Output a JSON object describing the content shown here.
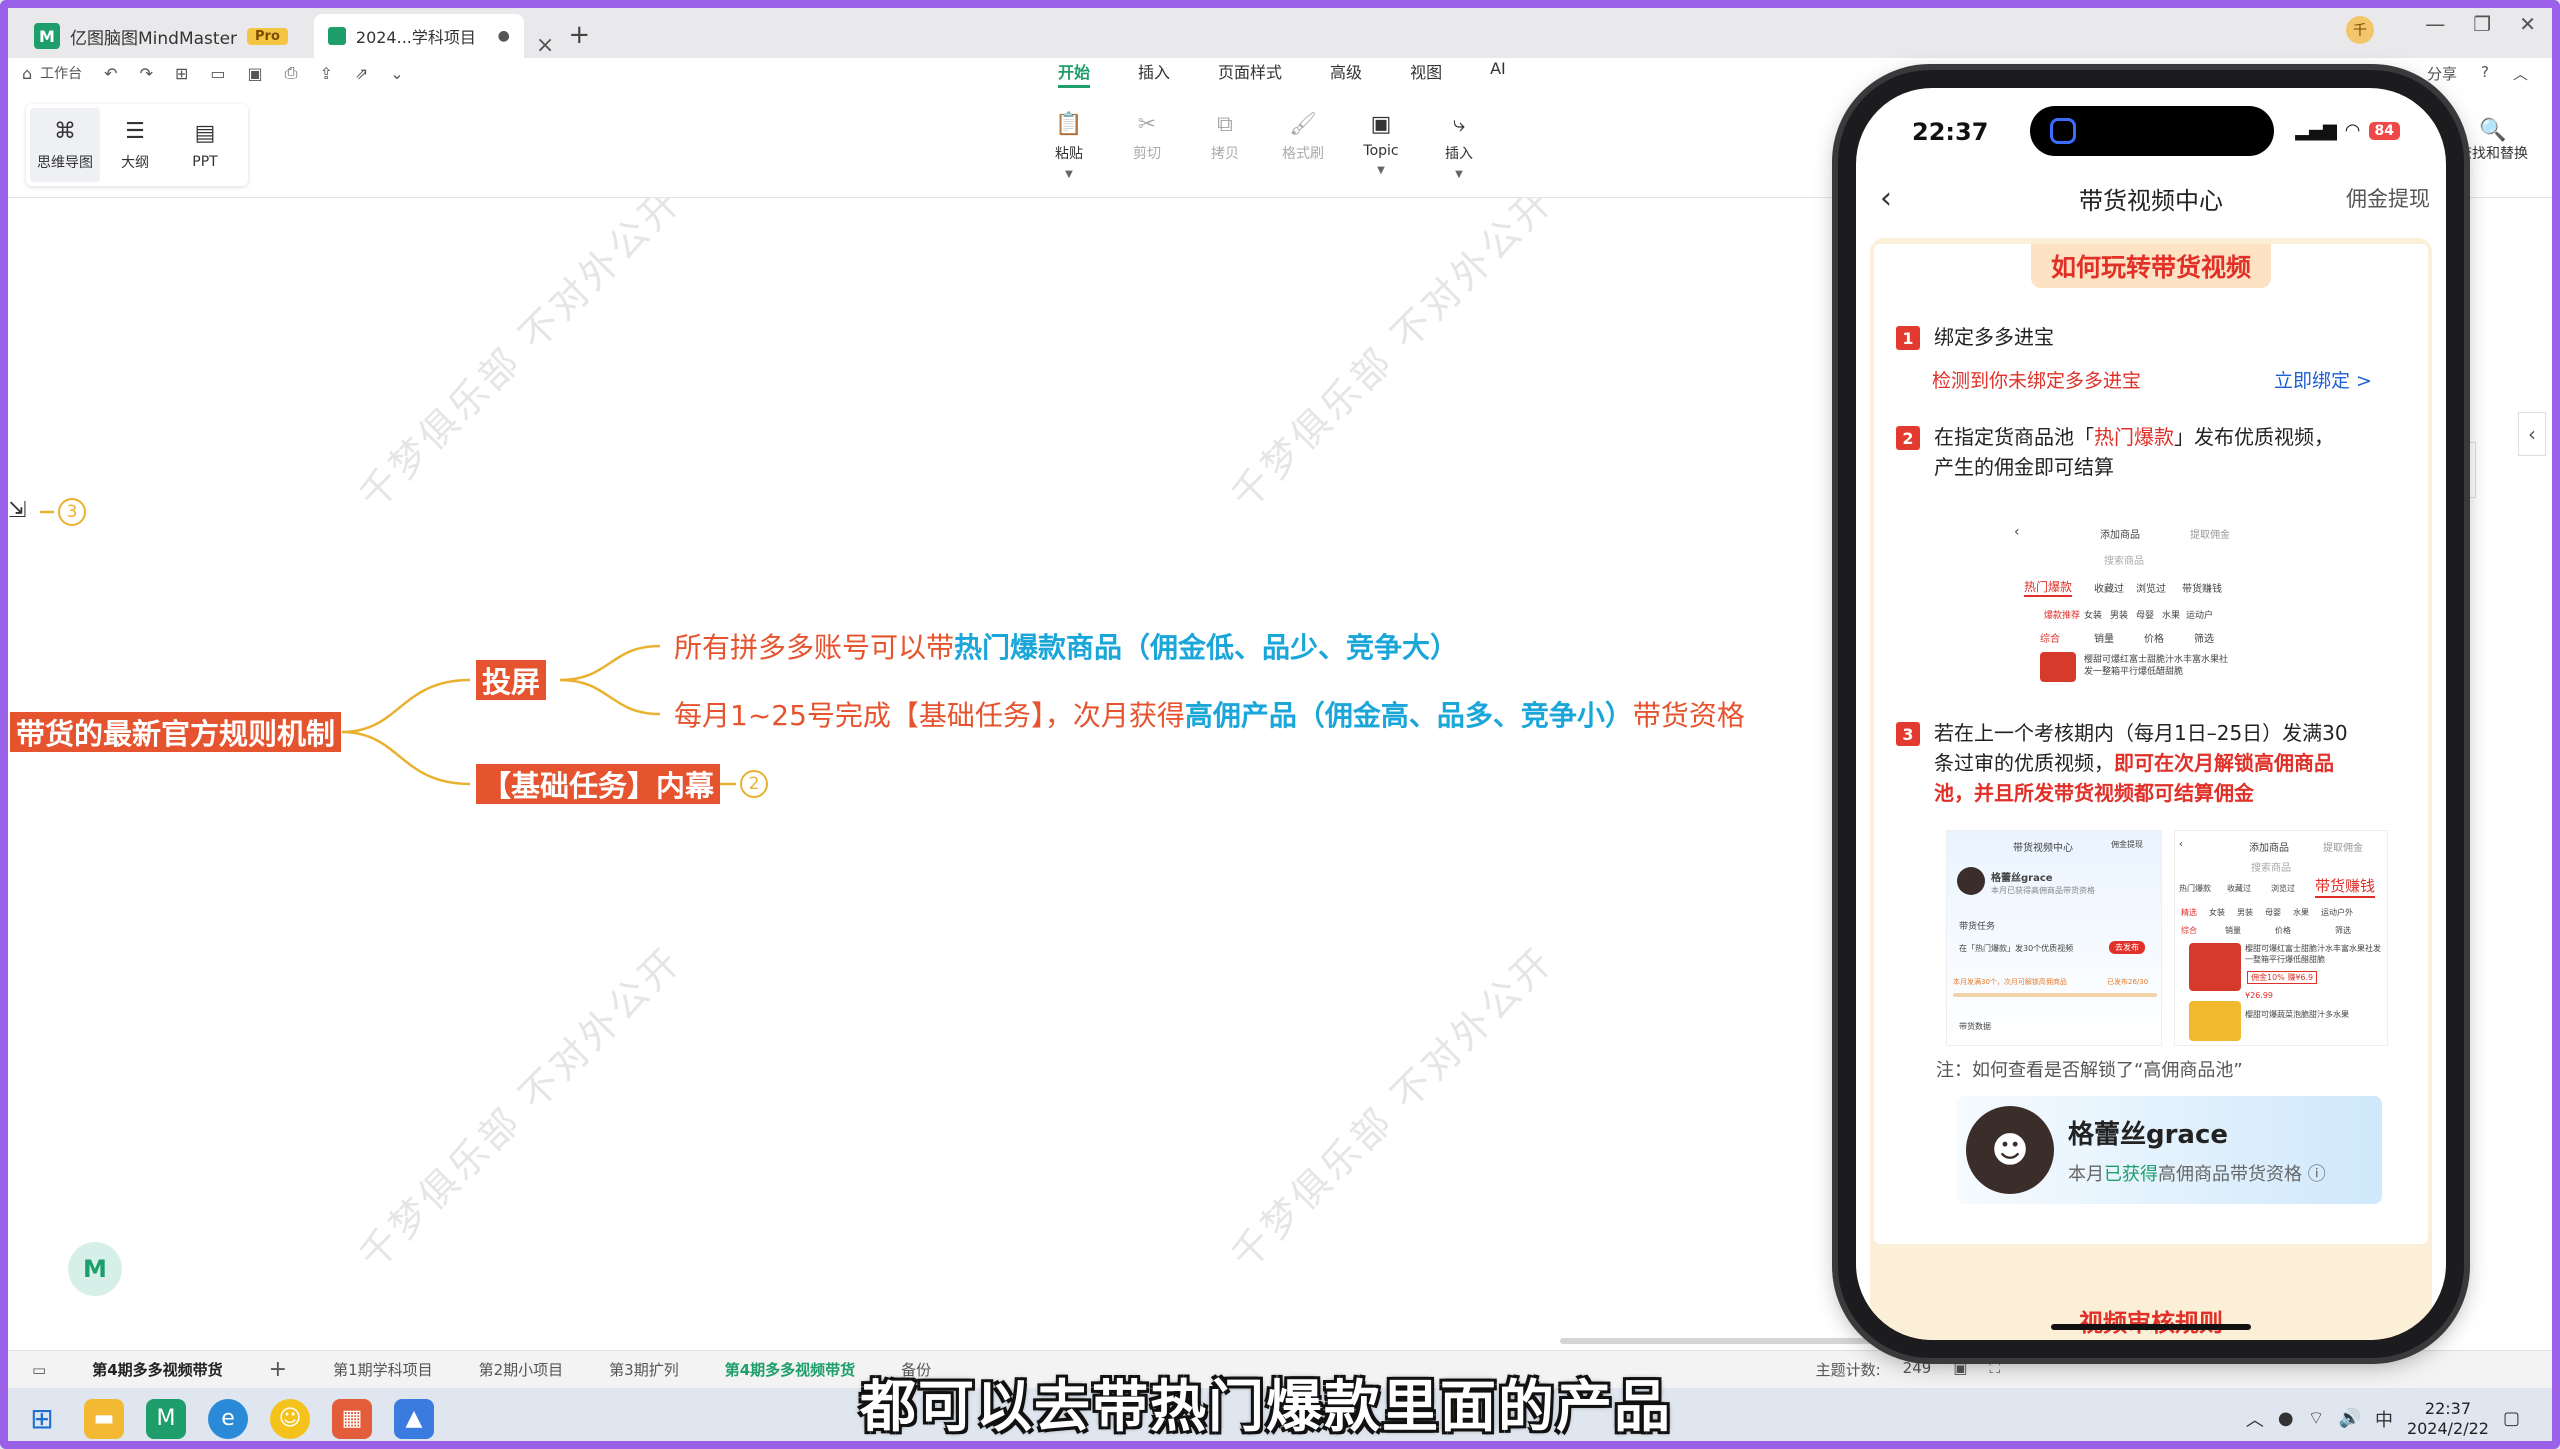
{
  "titlebar": {
    "app_name": "亿图脑图MindMaster",
    "pro_badge": "Pro",
    "doc_tab": "2024...学科项目",
    "doc_tab_dot": "●",
    "avatar_char": "千"
  },
  "menubar": {
    "workspace": "工作台",
    "tabs": [
      "开始",
      "插入",
      "页面样式",
      "高级",
      "视图",
      "AI"
    ],
    "share": "分享"
  },
  "ribbon": {
    "views": [
      {
        "label": "思维导图",
        "icon": "mindmap-icon"
      },
      {
        "label": "大纲",
        "icon": "outline-icon"
      },
      {
        "label": "PPT",
        "icon": "ppt-icon"
      }
    ],
    "tools": [
      {
        "label": "粘贴",
        "dim": false
      },
      {
        "label": "剪切",
        "dim": true
      },
      {
        "label": "拷贝",
        "dim": true
      },
      {
        "label": "格式刷",
        "dim": true
      },
      {
        "label": "Topic",
        "dim": false
      },
      {
        "label": "插入",
        "dim": false
      }
    ],
    "find_replace": "查找和替换"
  },
  "mindmap": {
    "central": "带货的最新官方规则机制",
    "badge_top": "3",
    "subtopic_1": "投屏",
    "leaf_1_pre": "所有拼多多账号可以带",
    "leaf_1_hl": "热门爆款商品（佣金低、品少、竞争大）",
    "leaf_2_pre": "每月1~25号完成【基础任务】，次月获得",
    "leaf_2_hl": "高佣产品（佣金高、品多、竞争小）",
    "leaf_2_post": "带货资格",
    "subtopic_2": "【基础任务】内幕",
    "badge_2": "2",
    "watermark": "千梦俱乐部  不对外公开"
  },
  "statusbar": {
    "pages": [
      "第4期多多视频带货",
      "第1期学科项目",
      "第2期小项目",
      "第3期扩列",
      "第4期多多视频带货",
      "备份"
    ],
    "topic_count_label": "主题计数:",
    "topic_count": "249"
  },
  "subtitle": "都可以去带热门爆款里面的产品",
  "taskbar": {
    "time": "22:37",
    "date": "2024/2/22",
    "ime": "中"
  },
  "phone": {
    "time": "22:37",
    "battery": "84",
    "nav_title": "带货视频中心",
    "nav_right": "佣金提现",
    "card_title": "如何玩转带货视频",
    "step1_num": "1",
    "step1_text": "绑定多多进宝",
    "step1_warn": "检测到你未绑定多多进宝",
    "step1_link": "立即绑定 >",
    "step2_num": "2",
    "step2_pre": "在指定货商品池「",
    "step2_red": "热门爆款",
    "step2_post": "」发布优质视频，",
    "step2_line2": "产生的佣金即可结算",
    "shot1": {
      "tab_add": "添加商品",
      "tab_rec": "提取佣金",
      "search": "搜索商品",
      "hot": "热门爆款",
      "fav": "收藏过",
      "browsed": "浏览过",
      "earn": "带货赚钱",
      "filters": [
        "爆款推荐",
        "女装",
        "男装",
        "母婴",
        "水果",
        "运动户"
      ],
      "sort": [
        "综合",
        "销量",
        "价格",
        "筛选"
      ],
      "item": "樱甜可爆红富士甜脆汁水丰富水果社发一整箱平行爆低醋甜脆"
    },
    "step3_num": "3",
    "step3_line1": "若在上一个考核期内（每月1日–25日）发满30",
    "step3_line2_pre": "条过审的优质视频，",
    "step3_line2_red": "即可在次月解锁高佣商品",
    "step3_line3_red": "池，并且所发带货视频都可结算佣金",
    "shot2": {
      "title": "带货视频中心",
      "withdraw": "佣金提现",
      "name": "格蕾丝grace",
      "sub": "本月已获得高佣商品带货资格",
      "task": "带货任务",
      "task_detail": "在「热门爆款」发30个优质视频",
      "btn": "去发布",
      "progress": "本月发满30个，次月可解锁高佣商品",
      "progress_count": "已发布26/30",
      "data": "带货数据"
    },
    "shot3": {
      "tab_add": "添加商品",
      "tab_rec": "提取佣金",
      "search": "搜索商品",
      "earn": "带货赚钱",
      "hot": "热门爆款",
      "fav": "收藏过",
      "browsed": "浏览过",
      "filters": [
        "精选",
        "女装",
        "男装",
        "母婴",
        "水果",
        "运动户外"
      ],
      "sort": [
        "综合",
        "销量",
        "价格",
        "筛选"
      ],
      "item": "樱甜可爆红富士甜脆汁水丰富水果社发一整箱平行爆低醋甜脆",
      "price_tag": "佣金10% 赚¥6.9",
      "price": "¥26.99",
      "item2": "樱甜可爆蔬菜泡脆甜汁多水果"
    },
    "note": "注：如何查看是否解锁了“高佣商品池”",
    "profile_name": "格蕾丝grace",
    "profile_pre": "本月",
    "profile_green": "已获得",
    "profile_post": "高佣商品带货资格",
    "next_title": "视频审核规则"
  }
}
